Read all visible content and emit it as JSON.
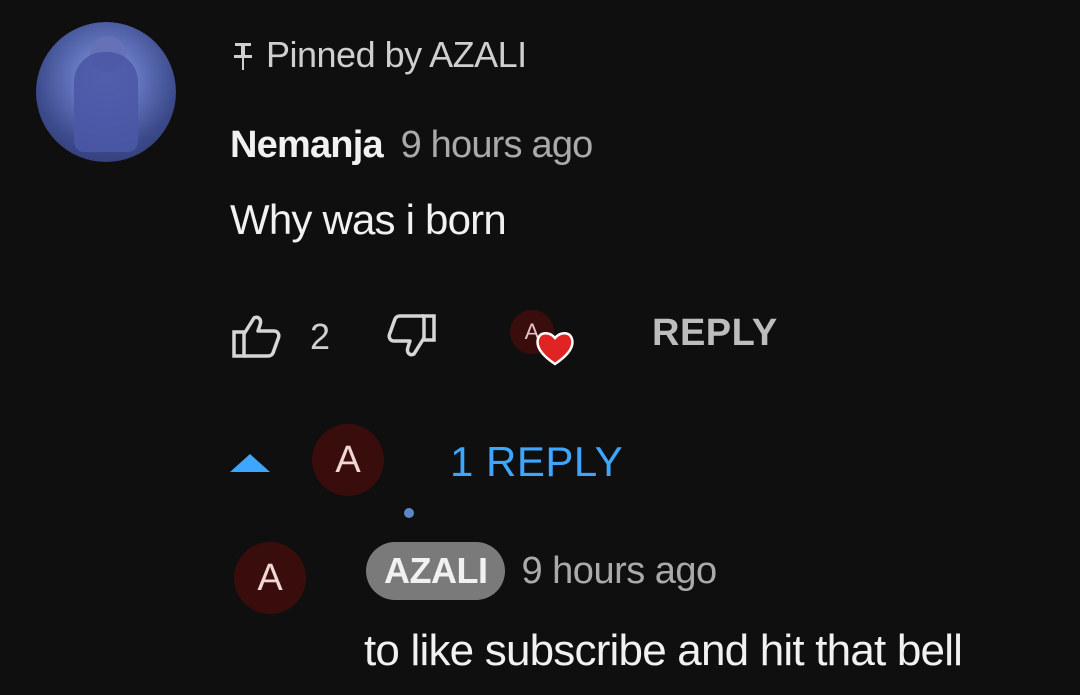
{
  "comment": {
    "pinned_label": "Pinned by AZALI",
    "author": "Nemanja",
    "time": "9 hours ago",
    "text": "Why was i born",
    "like_count": "2",
    "reply_button": "REPLY",
    "creator_heart_avatar_letter": "A"
  },
  "replies_toggle": {
    "avatar_letter": "A",
    "label": "1 REPLY"
  },
  "reply": {
    "avatar_letter": "A",
    "author": "AZALI",
    "time": "9 hours ago",
    "text": "to like subscribe and hit that bell"
  },
  "colors": {
    "background": "#0f0f0f",
    "link_blue": "#3ea6ff",
    "heart_red": "#e02424",
    "avatar_maroon": "#3a0d0d",
    "author_chip": "#7a7a7a"
  },
  "icons": [
    "pin-icon",
    "thumbs-up-icon",
    "thumbs-down-icon",
    "creator-heart-icon",
    "caret-up-icon"
  ]
}
